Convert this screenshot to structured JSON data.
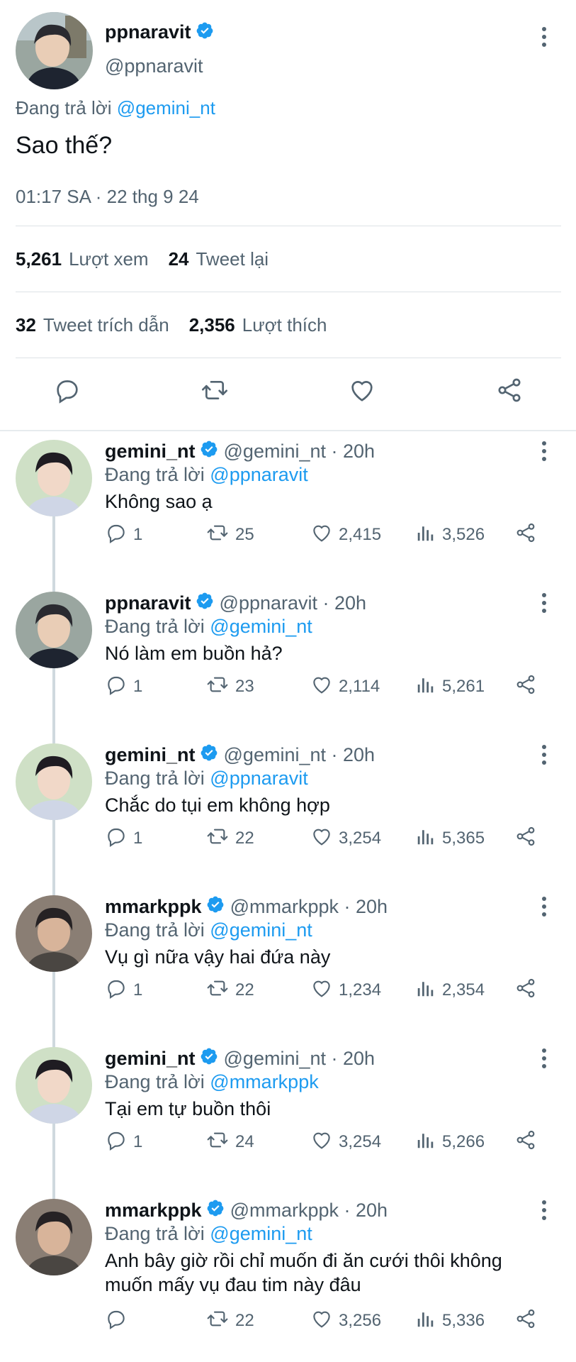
{
  "main_tweet": {
    "name": "ppnaravit",
    "handle": "@ppnaravit",
    "replying_prefix": "Đang trả lời",
    "replying_to": "@gemini_nt",
    "text": "Sao thế?",
    "timestamp": "01:17 SA · 22 thg 9 24",
    "views_count": "5,261",
    "views_label": "Lượt xem",
    "retweets_count": "24",
    "retweets_label": "Tweet lại",
    "quotes_count": "32",
    "quotes_label": "Tweet trích dẫn",
    "likes_count": "2,356",
    "likes_label": "Lượt thích",
    "icons": [
      "reply-icon",
      "retweet-icon",
      "like-icon",
      "share-icon"
    ]
  },
  "replies": [
    {
      "name": "gemini_nt",
      "handle": "@gemini_nt · 20h",
      "replying_prefix": "Đang trả lời",
      "replying_to": "@ppnaravit",
      "text": "Không sao ạ",
      "reply_count": "1",
      "retweet_count": "25",
      "like_count": "2,415",
      "view_count": "3,526"
    },
    {
      "name": "ppnaravit",
      "handle": "@ppnaravit · 20h",
      "replying_prefix": "Đang trả lời",
      "replying_to": "@gemini_nt",
      "text": "Nó làm em buồn hả?",
      "reply_count": "1",
      "retweet_count": "23",
      "like_count": "2,114",
      "view_count": "5,261"
    },
    {
      "name": "gemini_nt",
      "handle": "@gemini_nt · 20h",
      "replying_prefix": "Đang trả lời",
      "replying_to": "@ppnaravit",
      "text": "Chắc do tụi em không hợp",
      "reply_count": "1",
      "retweet_count": "22",
      "like_count": "3,254",
      "view_count": "5,365"
    },
    {
      "name": "mmarkppk",
      "handle": "@mmarkppk · 20h",
      "replying_prefix": "Đang trả lời",
      "replying_to": "@gemini_nt",
      "text": "Vụ gì nữa vậy hai đứa này",
      "reply_count": "1",
      "retweet_count": "22",
      "like_count": "1,234",
      "view_count": "2,354"
    },
    {
      "name": "gemini_nt",
      "handle": "@gemini_nt · 20h",
      "replying_prefix": "Đang trả lời",
      "replying_to": "@mmarkppk",
      "text": "Tại em tự buồn thôi",
      "reply_count": "1",
      "retweet_count": "24",
      "like_count": "3,254",
      "view_count": "5,266"
    },
    {
      "name": "mmarkppk",
      "handle": "@mmarkppk · 20h",
      "replying_prefix": "Đang trả lời",
      "replying_to": "@gemini_nt",
      "text": "Anh bây giờ rồi chỉ muốn đi ăn cưới thôi không muốn mấy vụ đau tim này đâu",
      "reply_count": "",
      "retweet_count": "22",
      "like_count": "3,256",
      "view_count": "5,336"
    }
  ],
  "colors": {
    "accent": "#1d9bf0",
    "text_primary": "#0f1419",
    "text_secondary": "#536471",
    "divider": "#dde2e6"
  }
}
